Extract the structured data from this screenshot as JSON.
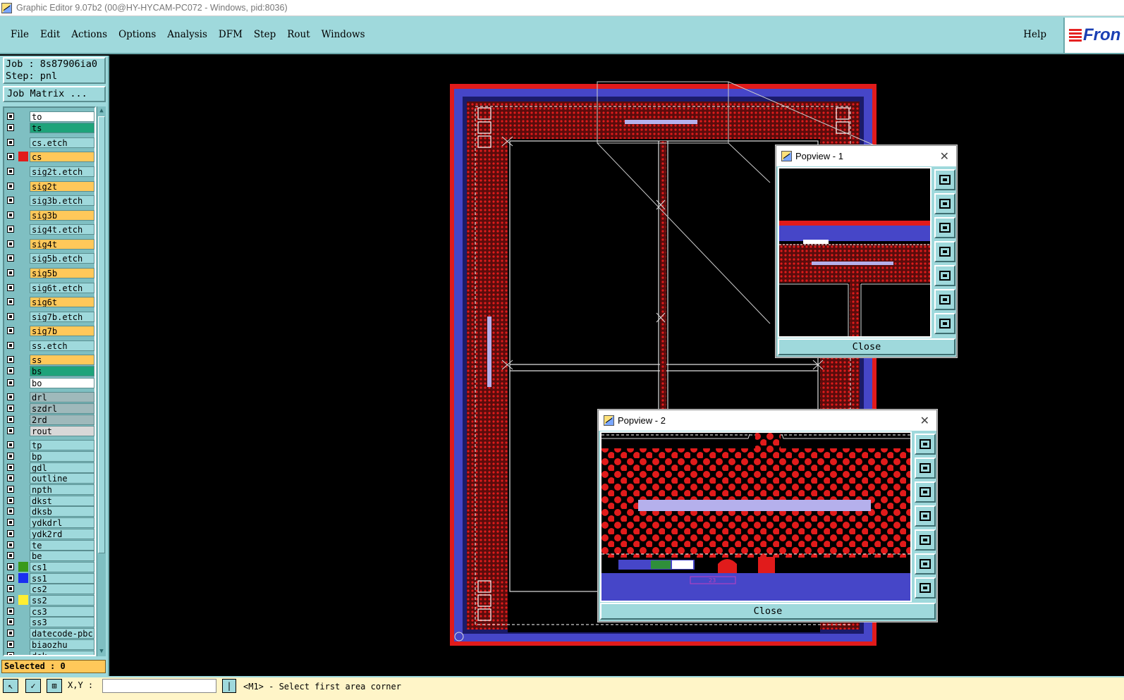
{
  "window": {
    "title": "Graphic Editor 9.07b2 (00@HY-HYCAM-PC072 - Windows, pid:8036)"
  },
  "menubar": {
    "items": [
      "File",
      "Edit",
      "Actions",
      "Options",
      "Analysis",
      "DFM",
      "Step",
      "Rout",
      "Windows"
    ],
    "help": "Help",
    "logo": "Fron"
  },
  "left_panel": {
    "job": "Job : 8s87906ia0",
    "step": "Step: pnl",
    "job_matrix": "Job Matrix ...",
    "layers": [
      {
        "name": "to",
        "color": "#ffffff",
        "chip": ""
      },
      {
        "name": "ts",
        "color": "#1ea37a",
        "chip": ""
      },
      {
        "name": "cs.etch",
        "color": "#9fd9dc",
        "chip": ""
      },
      {
        "name": "cs",
        "color": "#ffc85a",
        "chip": "#e11b1b"
      },
      {
        "name": "sig2t.etch",
        "color": "#9fd9dc",
        "chip": ""
      },
      {
        "name": "sig2t",
        "color": "#ffc85a",
        "chip": ""
      },
      {
        "name": "sig3b.etch",
        "color": "#9fd9dc",
        "chip": ""
      },
      {
        "name": "sig3b",
        "color": "#ffc85a",
        "chip": ""
      },
      {
        "name": "sig4t.etch",
        "color": "#9fd9dc",
        "chip": ""
      },
      {
        "name": "sig4t",
        "color": "#ffc85a",
        "chip": ""
      },
      {
        "name": "sig5b.etch",
        "color": "#9fd9dc",
        "chip": ""
      },
      {
        "name": "sig5b",
        "color": "#ffc85a",
        "chip": ""
      },
      {
        "name": "sig6t.etch",
        "color": "#9fd9dc",
        "chip": ""
      },
      {
        "name": "sig6t",
        "color": "#ffc85a",
        "chip": ""
      },
      {
        "name": "sig7b.etch",
        "color": "#9fd9dc",
        "chip": ""
      },
      {
        "name": "sig7b",
        "color": "#ffc85a",
        "chip": ""
      },
      {
        "name": "ss.etch",
        "color": "#9fd9dc",
        "chip": ""
      },
      {
        "name": "ss",
        "color": "#ffc85a",
        "chip": ""
      },
      {
        "name": "bs",
        "color": "#1ea37a",
        "chip": ""
      },
      {
        "name": "bo",
        "color": "#ffffff",
        "chip": ""
      },
      {
        "name": "drl",
        "color": "#9fb9bb",
        "chip": ""
      },
      {
        "name": "szdrl",
        "color": "#9fb9bb",
        "chip": ""
      },
      {
        "name": "2rd",
        "color": "#9fb9bb",
        "chip": ""
      },
      {
        "name": "rout",
        "color": "#d8d8d8",
        "chip": ""
      },
      {
        "name": "tp",
        "color": "#9fd9dc",
        "chip": ""
      },
      {
        "name": "bp",
        "color": "#9fd9dc",
        "chip": ""
      },
      {
        "name": "gdl",
        "color": "#9fd9dc",
        "chip": ""
      },
      {
        "name": "outline",
        "color": "#9fd9dc",
        "chip": ""
      },
      {
        "name": "npth",
        "color": "#9fd9dc",
        "chip": ""
      },
      {
        "name": "dkst",
        "color": "#9fd9dc",
        "chip": ""
      },
      {
        "name": "dksb",
        "color": "#9fd9dc",
        "chip": ""
      },
      {
        "name": "ydkdrl",
        "color": "#9fd9dc",
        "chip": ""
      },
      {
        "name": "ydk2rd",
        "color": "#9fd9dc",
        "chip": ""
      },
      {
        "name": "te",
        "color": "#9fd9dc",
        "chip": ""
      },
      {
        "name": "be",
        "color": "#9fd9dc",
        "chip": ""
      },
      {
        "name": "cs1",
        "color": "#9fd9dc",
        "chip": "#3a9a1c"
      },
      {
        "name": "ss1",
        "color": "#9fd9dc",
        "chip": "#1a2ff0"
      },
      {
        "name": "cs2",
        "color": "#9fd9dc",
        "chip": ""
      },
      {
        "name": "ss2",
        "color": "#9fd9dc",
        "chip": "#ffee33"
      },
      {
        "name": "cs3",
        "color": "#9fd9dc",
        "chip": ""
      },
      {
        "name": "ss3",
        "color": "#9fd9dc",
        "chip": ""
      },
      {
        "name": "datecode-pbc",
        "color": "#9fd9dc",
        "chip": ""
      },
      {
        "name": "biaozhu",
        "color": "#9fd9dc",
        "chip": ""
      },
      {
        "name": "dek",
        "color": "#9fd9dc",
        "chip": ""
      }
    ],
    "selected": "Selected : 0"
  },
  "status": {
    "xy_label": "X,Y :",
    "xy_value": "",
    "prompt": "<M1> - Select first area corner"
  },
  "popview1": {
    "title": "Popview - 1",
    "close": "Close"
  },
  "popview2": {
    "title": "Popview - 2",
    "close": "Close",
    "text_tag": "23"
  },
  "colors": {
    "panel": "#9fd9dc",
    "copper": "#e11b1b",
    "mask": "#4646c8",
    "highlight": "#b5b0ec"
  }
}
